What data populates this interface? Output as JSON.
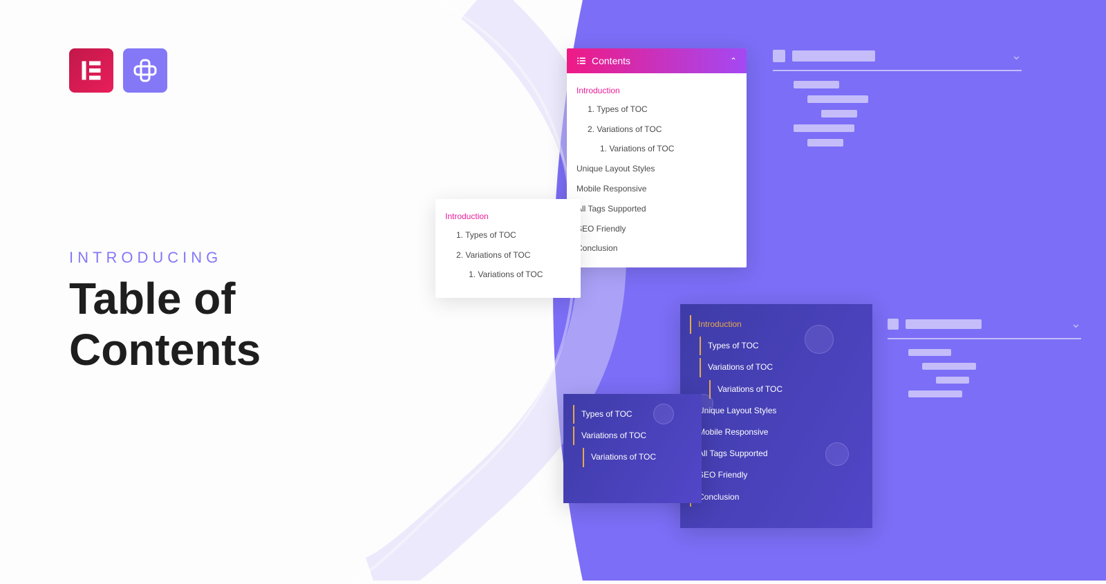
{
  "hero": {
    "kicker": "INTRODUCING",
    "title_line1": "Table of",
    "title_line2": "Contents"
  },
  "toc_main": {
    "header": "Contents",
    "intro": "Introduction",
    "item1": "1. Types of TOC",
    "item2": "2. Variations of TOC",
    "item2a": "1. Variations of TOC",
    "s1": "Unique Layout Styles",
    "s2": "Mobile Responsive",
    "s3": "All Tags Supported",
    "s4": "SEO Friendly",
    "s5": "Conclusion"
  },
  "toc_small": {
    "intro": "Introduction",
    "item1": "1. Types of TOC",
    "item2": "2. Variations of TOC",
    "item2a": "1. Variations of TOC"
  },
  "toc_dark_main": {
    "intro": "Introduction",
    "t1": "Types of TOC",
    "t2": "Variations of TOC",
    "t2a": "Variations of TOC",
    "s1": "Unique Layout Styles",
    "s2": "Mobile Responsive",
    "s3": "All Tags Supported",
    "s4": "SEO Friendly",
    "s5": "Conclusion"
  },
  "toc_dark_small": {
    "t1": "Types of TOC",
    "t2": "Variations of TOC",
    "t2a": "Variations of TOC"
  }
}
